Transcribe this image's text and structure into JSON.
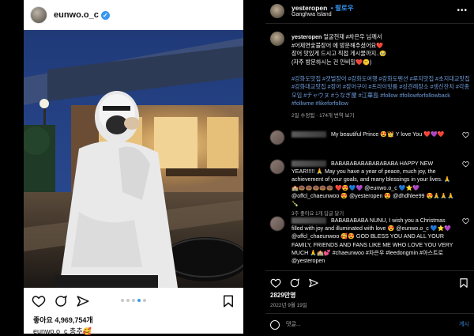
{
  "left_post": {
    "username": "eunwo.o_c",
    "verified_badge": "✓",
    "likes": "좋아요 4,969,754개",
    "caption": "eunwo.o_c 충추🥰",
    "carousel": {
      "total": 5,
      "active_index": 3
    },
    "icons": [
      "heart-icon",
      "comment-icon",
      "share-icon",
      "bookmark-icon"
    ]
  },
  "right_panel": {
    "header": {
      "username": "yesteropen",
      "follow": "• 팔로우",
      "location": "Ganghwa Island",
      "more": "•••"
    },
    "post": {
      "username": "yesteropen",
      "lines": [
        "얼굴천재 #차은우 님께서",
        "#어제연숯불장어 에 방문해주셨어요❤️",
        "장어 맛있게 드시고 직접 게시물까지..🥹",
        "(자주 방문하시는 건 안비밀❤️🤫)"
      ],
      "hashtags": "#강화도맛집 #갯벌장어 #강화도여행 #강화도펜션 #루지맛집 #초지대교맛집 #강화대교맛집 #장어 #장어구이 #프라이빗룸 #상견례장소 #생신잔치 #각종모임 #チャウヌ #うなぎ屋 #江華島 #follow #followforfollowback #follwme #likeforfollow",
      "meta": "2일  수정됨 · 174개  번역 보기"
    },
    "comments": [
      {
        "text": "My beautiful Prince 😍👑 Y love You ❤️💜❤️",
        "meta": ""
      },
      {
        "text": "BABABABABABABABABA HAPPY NEW YEAR!!!!! 🙏 May you have a year of peace, much joy, the achievement of your goals, and many blessings in your lives. 🙏🏫🍩🍩🍩🍩🍩 ❤️😍💙💜 @eunwo.o_c 💙⭐💜 @offcl_chaeunwoo 😍 @yesteropen 😍 @dhdhlee99 😍🙏🙏🙏🍾",
        "meta": "3주  좋아요 1개  답글 달기"
      },
      {
        "text": "BABABABABA NUNU, I wish you a Christmas filled with joy and illuminated with love 😍 @eunwo.o_c 💙⭐💜 @offcl_chaeunwoo 🥰😍 GOD BLESS YOU AND ALL YOUR FAMILY, FRIENDS AND FANS LIKE ME WHO LOVE YOU VERY MUCH 🙏🏫💕 #chaeunwoo #차은우 #leedongmin #아스트로 @yesteropen",
        "meta": ""
      }
    ],
    "likes": "2829만명",
    "date": "2022년 9월 19일",
    "comment_placeholder": "댓글...",
    "post_button": "게시"
  },
  "colors": {
    "link": "#3897f0",
    "tag": "#6e9bd9",
    "panel_bg": "#000000"
  }
}
